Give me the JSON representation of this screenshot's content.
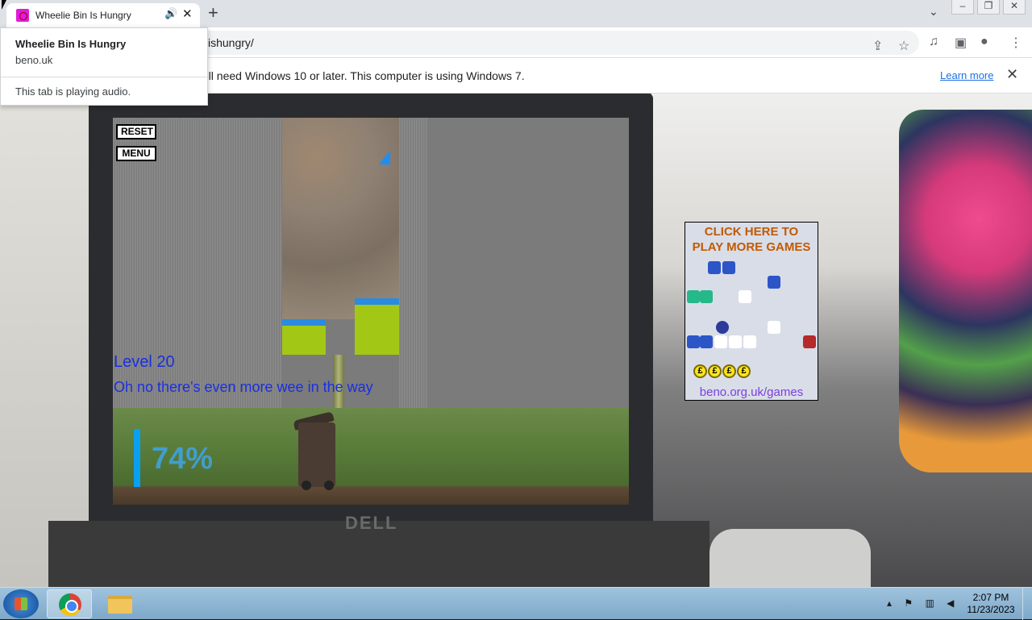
{
  "browser": {
    "tab_title": "Wheelie Bin Is Hungry",
    "tab_audio_icon": "speaker-icon",
    "tab_close_icon": "close-icon",
    "new_tab_icon": "plus-icon",
    "url": "ishungry/",
    "toolbar_icons": [
      "share-icon",
      "star-icon",
      "media-icon",
      "sidepanel-icon",
      "profile-icon",
      "menu-icon"
    ]
  },
  "hovercard": {
    "title": "Wheelie Bin Is Hungry",
    "domain": "beno.uk",
    "audio_text": "This tab is playing audio."
  },
  "infobar": {
    "message": "'ll need Windows 10 or later. This computer is using Windows 7.",
    "learn_more": "Learn more"
  },
  "game": {
    "reset_label": "RESET",
    "menu_label": "MENU",
    "level": "Level 20",
    "message": "Oh no there's even more wee in the way",
    "progress_text": "74%",
    "progress_value": 0.74,
    "colors": {
      "text": "#1a2fe0",
      "progress": "#0aa0f0"
    }
  },
  "ad": {
    "headline_line1": "CLICK HERE TO",
    "headline_line2": "PLAY MORE GAMES",
    "coins": [
      "£",
      "£",
      "£",
      "£"
    ],
    "link": "beno.org.uk/games"
  },
  "taskbar": {
    "time": "2:07 PM",
    "date": "11/23/2023"
  },
  "device": {
    "laptop_logo": "DELL"
  }
}
